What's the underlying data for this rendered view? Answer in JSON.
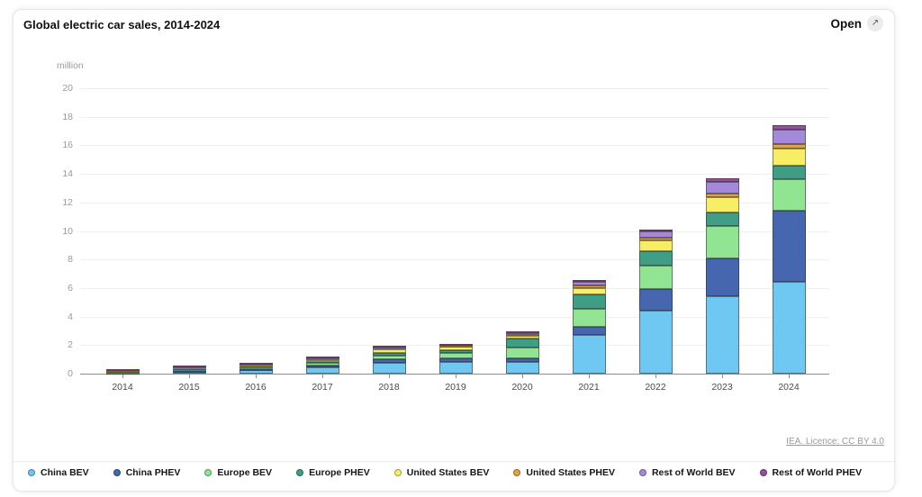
{
  "card": {
    "title": "Global electric car sales, 2014-2024",
    "open_label": "Open",
    "open_icon": "↗",
    "license_link": "IEA. Licence: CC BY 4.0"
  },
  "chart_data": {
    "type": "bar",
    "stacked": true,
    "title": "Global electric car sales, 2014-2024",
    "unit_label": "million",
    "xlabel": "",
    "ylabel": "million",
    "ylim": [
      0,
      20
    ],
    "ytick_step": 2,
    "grid": "horizontal",
    "legend_position": "bottom",
    "categories": [
      "2014",
      "2015",
      "2016",
      "2017",
      "2018",
      "2019",
      "2020",
      "2021",
      "2022",
      "2023",
      "2024"
    ],
    "series": [
      {
        "name": "China BEV",
        "color": "#6FC8F1",
        "values": [
          0.04,
          0.15,
          0.26,
          0.47,
          0.77,
          0.85,
          0.85,
          2.7,
          4.4,
          5.4,
          6.45
        ]
      },
      {
        "name": "China PHEV",
        "color": "#4667AF",
        "values": [
          0.03,
          0.06,
          0.08,
          0.11,
          0.27,
          0.22,
          0.2,
          0.6,
          1.5,
          2.7,
          4.95
        ]
      },
      {
        "name": "Europe BEV",
        "color": "#90E492",
        "values": [
          0.06,
          0.09,
          0.09,
          0.15,
          0.25,
          0.36,
          0.75,
          1.25,
          1.65,
          2.25,
          2.2
        ]
      },
      {
        "name": "Europe PHEV",
        "color": "#3F9E85",
        "values": [
          0.04,
          0.08,
          0.11,
          0.14,
          0.15,
          0.2,
          0.65,
          1.0,
          1.0,
          0.95,
          0.95
        ]
      },
      {
        "name": "United States BEV",
        "color": "#F8EE66",
        "values": [
          0.06,
          0.07,
          0.09,
          0.1,
          0.24,
          0.24,
          0.23,
          0.47,
          0.8,
          1.05,
          1.2
        ]
      },
      {
        "name": "United States PHEV",
        "color": "#E2A33C",
        "values": [
          0.05,
          0.04,
          0.07,
          0.09,
          0.12,
          0.08,
          0.08,
          0.17,
          0.19,
          0.25,
          0.35
        ]
      },
      {
        "name": "Rest of World BEV",
        "color": "#A489DB",
        "values": [
          0.02,
          0.04,
          0.04,
          0.08,
          0.1,
          0.12,
          0.15,
          0.25,
          0.45,
          0.85,
          1.0
        ]
      },
      {
        "name": "Rest of World PHEV",
        "color": "#95519A",
        "values": [
          0.01,
          0.02,
          0.02,
          0.03,
          0.04,
          0.04,
          0.05,
          0.1,
          0.12,
          0.25,
          0.3
        ]
      }
    ]
  }
}
